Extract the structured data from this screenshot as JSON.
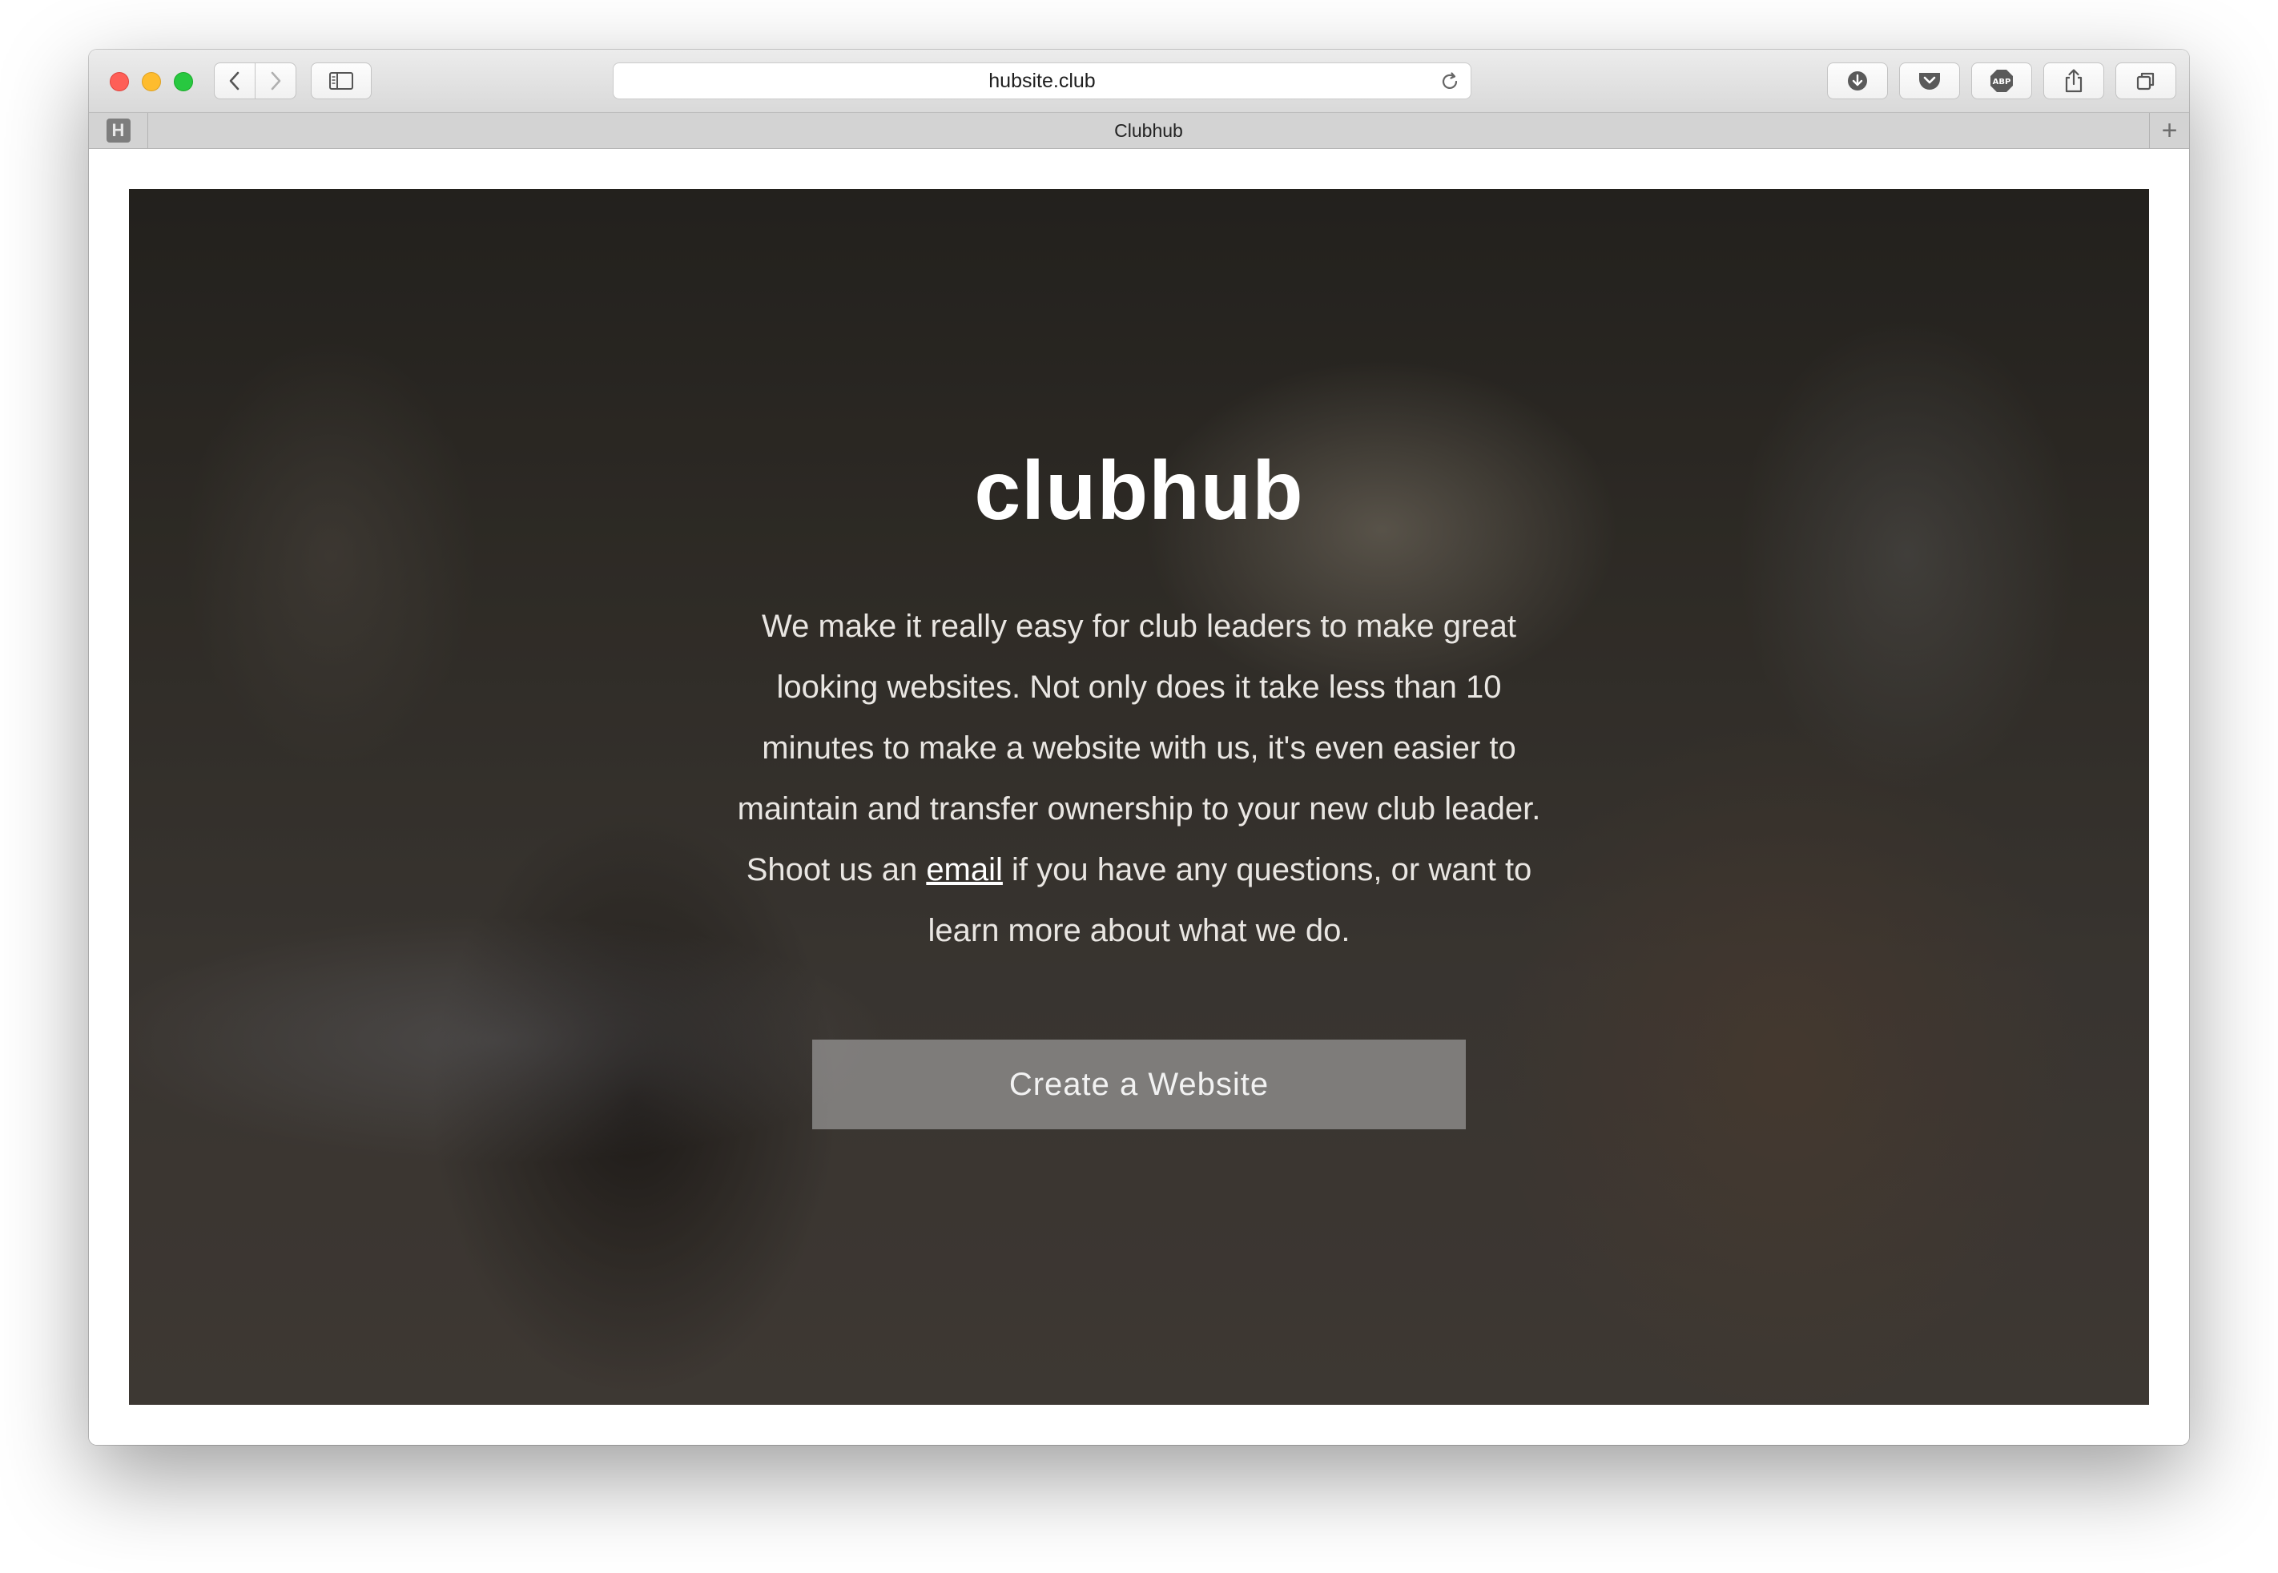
{
  "browser": {
    "url": "hubsite.club",
    "tab_title": "Clubhub",
    "pinned_tab_letter": "H",
    "new_tab_symbol": "+",
    "abp_label": "ABP"
  },
  "hero": {
    "title": "clubhub",
    "desc_before": "We make it really easy for club leaders to make great looking websites. Not only does it take less than 10 minutes to make a website with us, it's even easier to maintain and transfer ownership to your new club leader. Shoot us an ",
    "email_link": "email",
    "desc_after": " if you have any questions, or want to learn more about what we do.",
    "cta_label": "Create a Website"
  }
}
